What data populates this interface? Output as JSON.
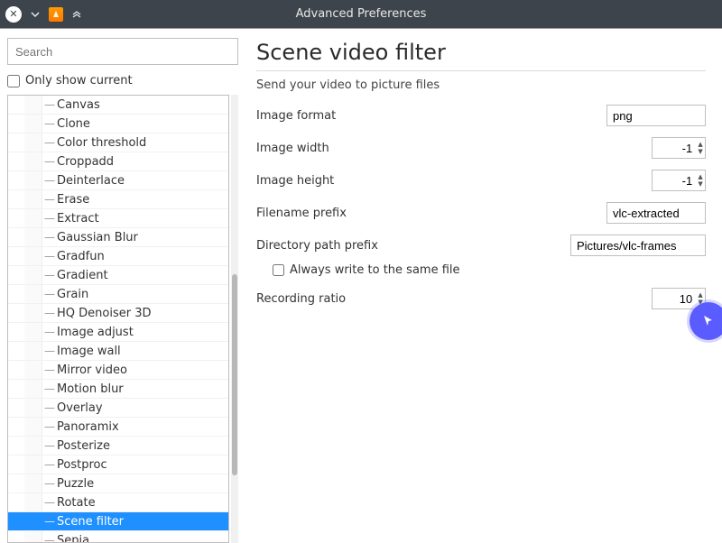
{
  "window": {
    "title": "Advanced Preferences"
  },
  "sidebar": {
    "search_placeholder": "Search",
    "only_show_current": "Only show current",
    "only_show_current_checked": false,
    "items": [
      {
        "label": "Canvas",
        "selected": false
      },
      {
        "label": "Clone",
        "selected": false
      },
      {
        "label": "Color threshold",
        "selected": false
      },
      {
        "label": "Croppadd",
        "selected": false
      },
      {
        "label": "Deinterlace",
        "selected": false
      },
      {
        "label": "Erase",
        "selected": false
      },
      {
        "label": "Extract",
        "selected": false
      },
      {
        "label": "Gaussian Blur",
        "selected": false
      },
      {
        "label": "Gradfun",
        "selected": false
      },
      {
        "label": "Gradient",
        "selected": false
      },
      {
        "label": "Grain",
        "selected": false
      },
      {
        "label": "HQ Denoiser 3D",
        "selected": false
      },
      {
        "label": "Image adjust",
        "selected": false
      },
      {
        "label": "Image wall",
        "selected": false
      },
      {
        "label": "Mirror video",
        "selected": false
      },
      {
        "label": "Motion blur",
        "selected": false
      },
      {
        "label": "Overlay",
        "selected": false
      },
      {
        "label": "Panoramix",
        "selected": false
      },
      {
        "label": "Posterize",
        "selected": false
      },
      {
        "label": "Postproc",
        "selected": false
      },
      {
        "label": "Puzzle",
        "selected": false
      },
      {
        "label": "Rotate",
        "selected": false
      },
      {
        "label": "Scene filter",
        "selected": true
      },
      {
        "label": "Sepia",
        "selected": false
      }
    ]
  },
  "panel": {
    "heading": "Scene video filter",
    "subtitle": "Send your video to picture files",
    "labels": {
      "image_format": "Image format",
      "image_width": "Image width",
      "image_height": "Image height",
      "filename_prefix": "Filename prefix",
      "directory_path_prefix": "Directory path prefix",
      "always_write": "Always write to the same file",
      "recording_ratio": "Recording ratio"
    },
    "values": {
      "image_format": "png",
      "image_width": "-1",
      "image_height": "-1",
      "filename_prefix": "vlc-extracted",
      "directory_path_prefix": "Pictures/vlc-frames",
      "always_write_checked": false,
      "recording_ratio": "10"
    }
  }
}
